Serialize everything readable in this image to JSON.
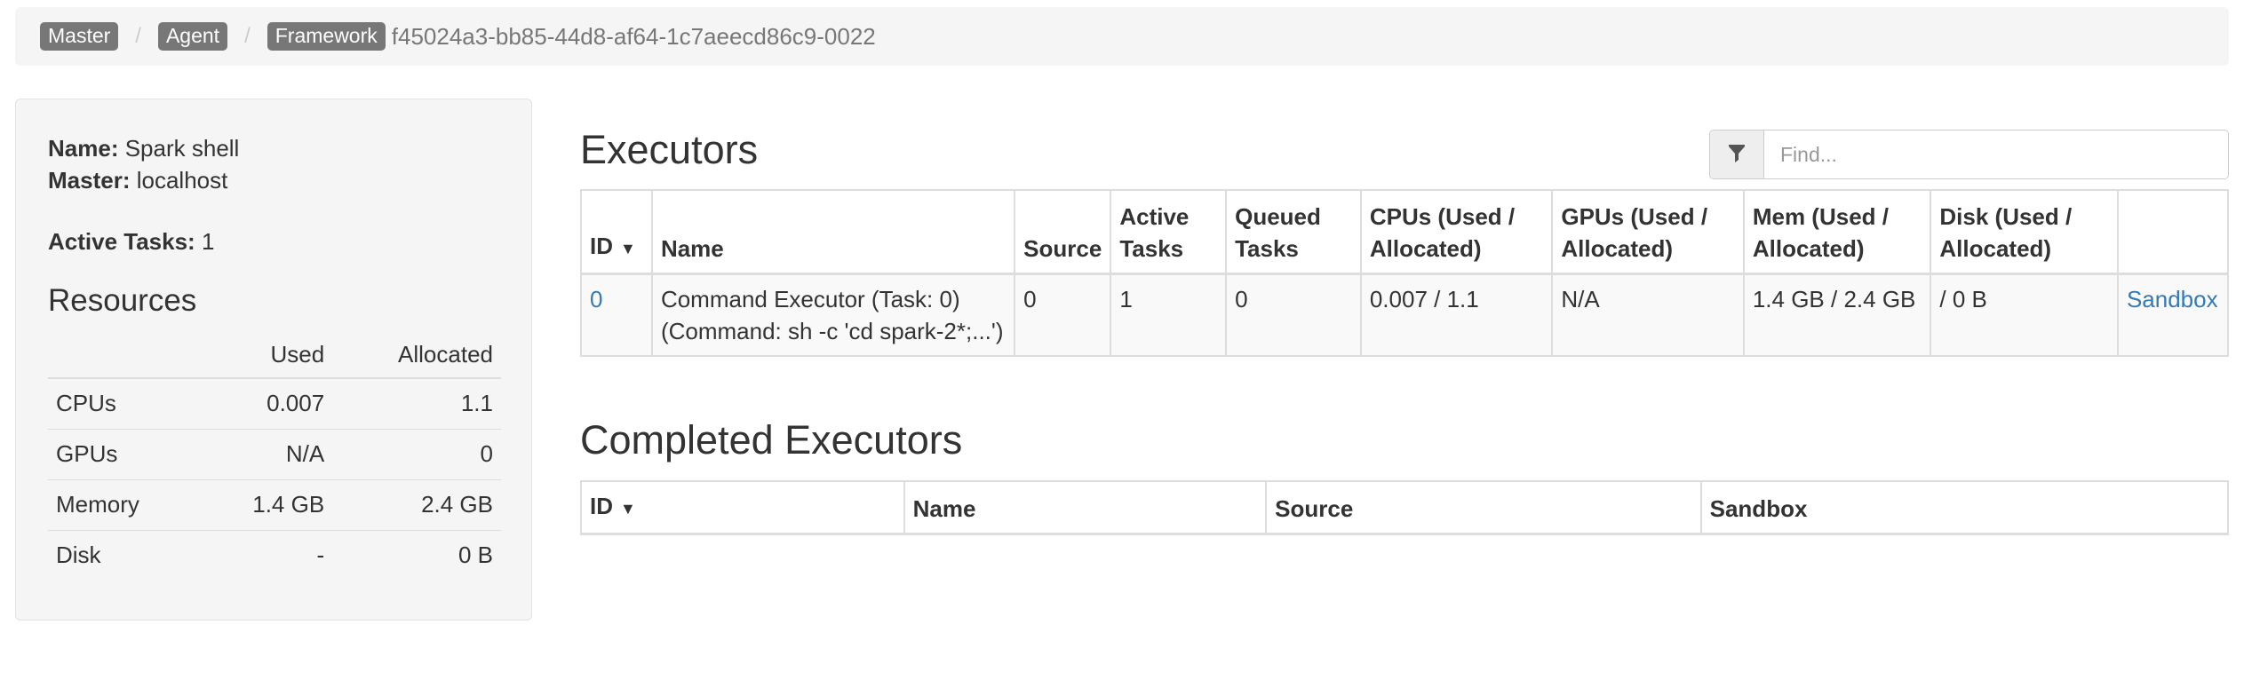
{
  "breadcrumb": {
    "items": [
      "Master",
      "Agent",
      "Framework"
    ],
    "separator": "/",
    "framework_id": "f45024a3-bb85-44d8-af64-1c7aeecd86c9-0022"
  },
  "summary": {
    "name_label": "Name:",
    "name_value": "Spark shell",
    "master_label": "Master:",
    "master_value": "localhost",
    "active_tasks_label": "Active Tasks:",
    "active_tasks_value": "1"
  },
  "resources": {
    "title": "Resources",
    "headers": [
      "",
      "Used",
      "Allocated"
    ],
    "rows": [
      {
        "label": "CPUs",
        "used": "0.007",
        "allocated": "1.1"
      },
      {
        "label": "GPUs",
        "used": "N/A",
        "allocated": "0"
      },
      {
        "label": "Memory",
        "used": "1.4 GB",
        "allocated": "2.4 GB"
      },
      {
        "label": "Disk",
        "used": "-",
        "allocated": "0 B"
      }
    ]
  },
  "executors": {
    "title": "Executors",
    "search_placeholder": "Find...",
    "headers": {
      "id": "ID",
      "sort_indicator": "▼",
      "name": "Name",
      "source": "Source",
      "active_tasks_1": "Active",
      "active_tasks_2": "Tasks",
      "queued_tasks_1": "Queued",
      "queued_tasks_2": "Tasks",
      "cpus_1": "CPUs (Used /",
      "cpus_2": "Allocated)",
      "gpus_1": "GPUs (Used /",
      "gpus_2": "Allocated)",
      "mem_1": "Mem (Used /",
      "mem_2": "Allocated)",
      "disk_1": "Disk (Used /",
      "disk_2": "Allocated)"
    },
    "rows": [
      {
        "id": "0",
        "name_1": "Command Executor (Task: 0)",
        "name_2": "(Command: sh -c 'cd spark-2*;...')",
        "source": "0",
        "active_tasks": "1",
        "queued_tasks": "0",
        "cpus": "0.007 / 1.1",
        "gpus": "N/A",
        "mem": "1.4 GB / 2.4 GB",
        "disk": "/ 0 B",
        "sandbox": "Sandbox"
      }
    ]
  },
  "completed_executors": {
    "title": "Completed Executors",
    "headers": {
      "id": "ID",
      "sort_indicator": "▼",
      "name": "Name",
      "source": "Source",
      "sandbox": "Sandbox"
    }
  },
  "colors": {
    "link": "#337ab7",
    "label_bg": "#777777",
    "panel_bg": "#f5f5f5",
    "border": "#dddddd"
  },
  "icons": {
    "filter": "filter-icon"
  }
}
